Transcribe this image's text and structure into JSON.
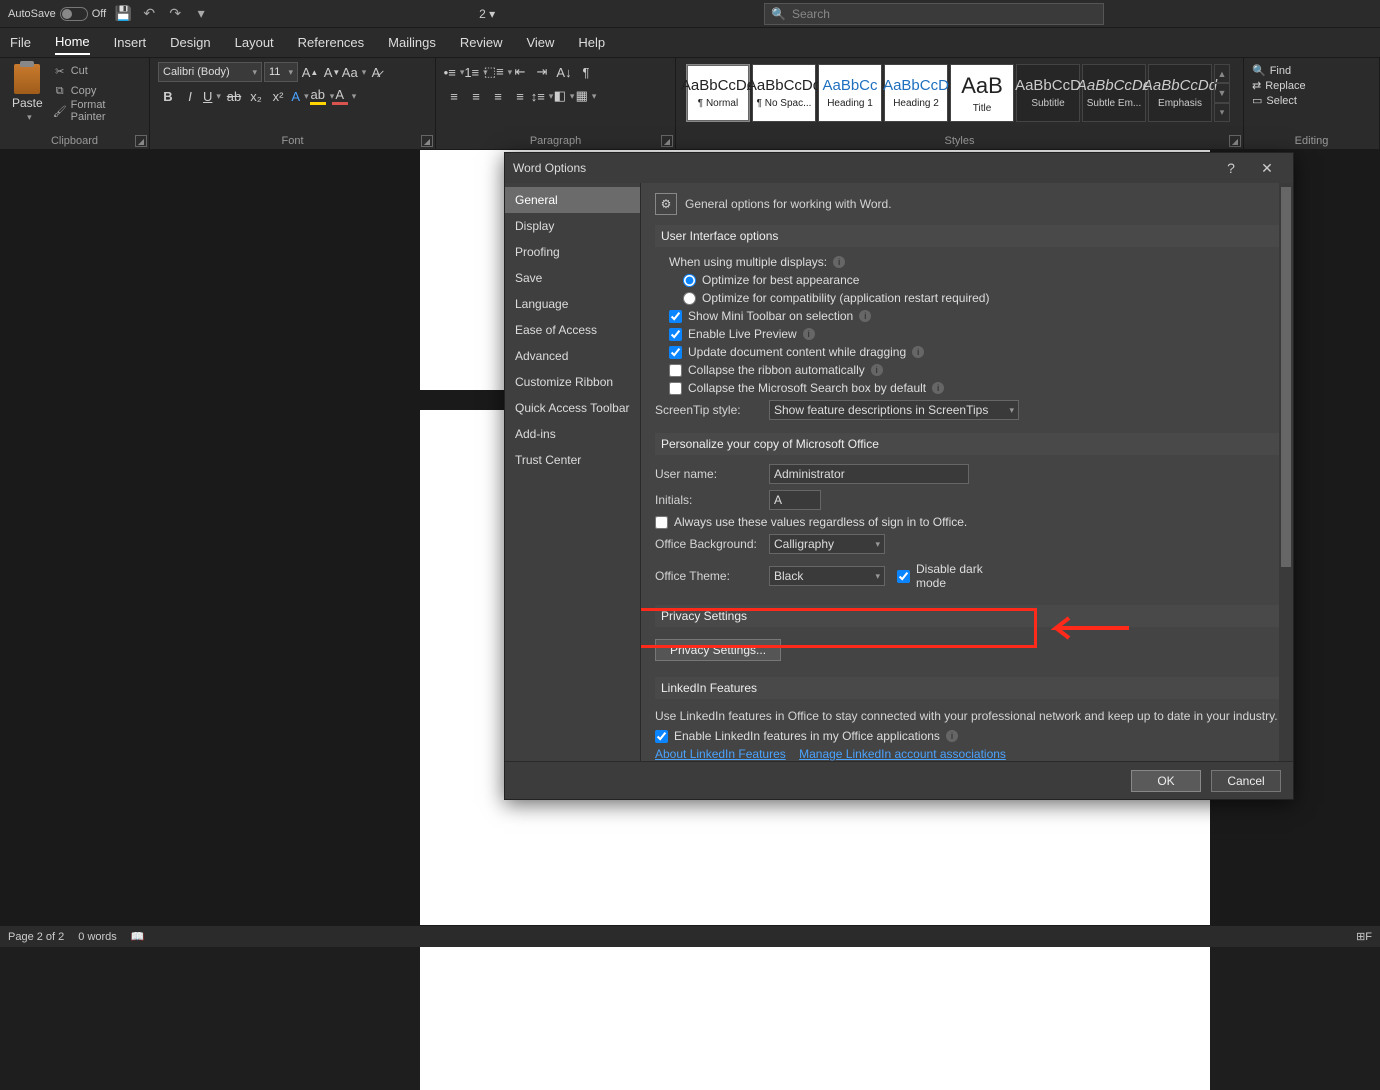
{
  "titlebar": {
    "autosave_label": "AutoSave",
    "autosave_state": "Off",
    "doc_title": "2 ▾",
    "search_placeholder": "Search"
  },
  "tabs": [
    "File",
    "Home",
    "Insert",
    "Design",
    "Layout",
    "References",
    "Mailings",
    "Review",
    "View",
    "Help"
  ],
  "active_tab": "Home",
  "ribbon": {
    "clipboard": {
      "label": "Clipboard",
      "paste": "Paste",
      "cut": "Cut",
      "copy": "Copy",
      "format_painter": "Format Painter"
    },
    "font": {
      "label": "Font",
      "name": "Calibri (Body)",
      "size": "11"
    },
    "paragraph": {
      "label": "Paragraph"
    },
    "styles": {
      "label": "Styles",
      "items": [
        {
          "preview": "AaBbCcDd",
          "name": "¶ Normal"
        },
        {
          "preview": "AaBbCcDd",
          "name": "¶ No Spac..."
        },
        {
          "preview": "AaBbCc",
          "name": "Heading 1"
        },
        {
          "preview": "AaBbCcD",
          "name": "Heading 2"
        },
        {
          "preview": "AaB",
          "name": "Title"
        },
        {
          "preview": "AaBbCcD",
          "name": "Subtitle"
        },
        {
          "preview": "AaBbCcDd",
          "name": "Subtle Em..."
        },
        {
          "preview": "AaBbCcDd",
          "name": "Emphasis"
        }
      ]
    },
    "editing": {
      "label": "Editing",
      "find": "Find",
      "replace": "Replace",
      "select": "Select"
    }
  },
  "dialog": {
    "title": "Word Options",
    "nav": [
      "General",
      "Display",
      "Proofing",
      "Save",
      "Language",
      "Ease of Access",
      "Advanced",
      "Customize Ribbon",
      "Quick Access Toolbar",
      "Add-ins",
      "Trust Center"
    ],
    "nav_selected": "General",
    "header": "General options for working with Word.",
    "ui_options": {
      "title": "User Interface options",
      "multi_displays": "When using multiple displays:",
      "opt_best": "Optimize for best appearance",
      "opt_compat": "Optimize for compatibility (application restart required)",
      "mini_toolbar": "Show Mini Toolbar on selection",
      "live_preview": "Enable Live Preview",
      "update_drag": "Update document content while dragging",
      "collapse_ribbon": "Collapse the ribbon automatically",
      "collapse_search": "Collapse the Microsoft Search box by default",
      "screentip_label": "ScreenTip style:",
      "screentip_value": "Show feature descriptions in ScreenTips"
    },
    "personalize": {
      "title": "Personalize your copy of Microsoft Office",
      "username_label": "User name:",
      "username_value": "Administrator",
      "initials_label": "Initials:",
      "initials_value": "A",
      "always_use": "Always use these values regardless of sign in to Office.",
      "bg_label": "Office Background:",
      "bg_value": "Calligraphy",
      "theme_label": "Office Theme:",
      "theme_value": "Black",
      "disable_dark": "Disable dark mode"
    },
    "privacy": {
      "title": "Privacy Settings",
      "button": "Privacy Settings..."
    },
    "linkedin": {
      "title": "LinkedIn Features",
      "desc": "Use LinkedIn features in Office to stay connected with your professional network and keep up to date in your industry.",
      "enable": "Enable LinkedIn features in my Office applications",
      "link1": "About LinkedIn Features",
      "link2": "Manage LinkedIn account associations"
    },
    "ok": "OK",
    "cancel": "Cancel"
  },
  "statusbar": {
    "page": "Page 2 of 2",
    "words": "0 words"
  }
}
